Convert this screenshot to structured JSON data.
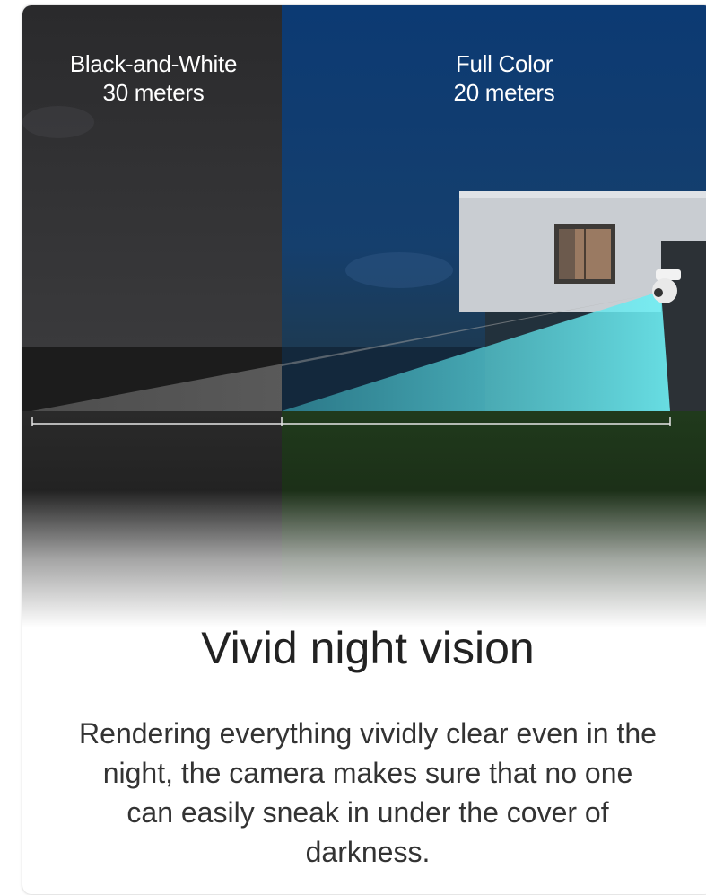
{
  "comparison": {
    "bw_title": "Black-and-White",
    "bw_range": "30 meters",
    "color_title": "Full Color",
    "color_range": "20 meters"
  },
  "feature": {
    "headline": "Vivid night vision",
    "description": "Rendering everything vividly clear even in the night, the camera makes sure that no one can easily sneak in under the cover of darkness."
  },
  "colors": {
    "night_gray": "#2b2b2d",
    "night_blue": "#0d3870",
    "beam_cyan": "#5fe4ec",
    "text_dark": "#222222"
  },
  "icons": [
    "security-camera-icon"
  ]
}
